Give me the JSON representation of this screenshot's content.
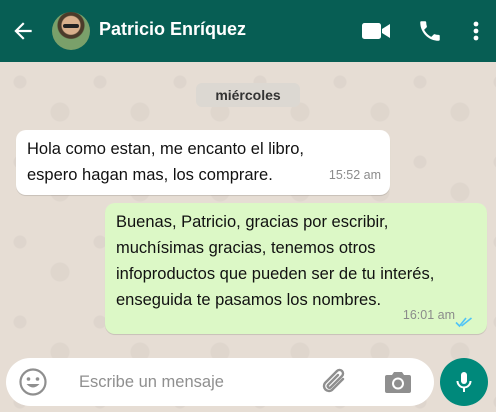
{
  "header": {
    "contact_name": "Patricio Enríquez",
    "back_icon": "arrow-left-icon",
    "video_icon": "video-camera-icon",
    "call_icon": "phone-icon",
    "menu_icon": "more-vertical-icon",
    "background_color": "#075e54"
  },
  "chat": {
    "date_label": "miércoles",
    "messages": [
      {
        "direction": "incoming",
        "text_lines": [
          "Hola como estan, me encanto el libro,",
          "espero hagan mas, los comprare."
        ],
        "time": "15:52 am"
      },
      {
        "direction": "outgoing",
        "text_lines": [
          "Buenas, Patricio, gracias por escribir,",
          "muchísimas gracias, tenemos otros",
          "infoproductos que pueden ser de tu interés,",
          "enseguida te pasamos los nombres."
        ],
        "time": "16:01 am",
        "status": "read"
      }
    ],
    "incoming_color": "#ffffff",
    "outgoing_color": "#dcf8c6",
    "read_tick_color": "#4fc3f7"
  },
  "composer": {
    "placeholder": "Escribe un mensaje",
    "emoji_icon": "emoji-icon",
    "attach_icon": "paperclip-icon",
    "camera_icon": "camera-icon",
    "mic_icon": "microphone-icon",
    "mic_button_color": "#00897b"
  }
}
